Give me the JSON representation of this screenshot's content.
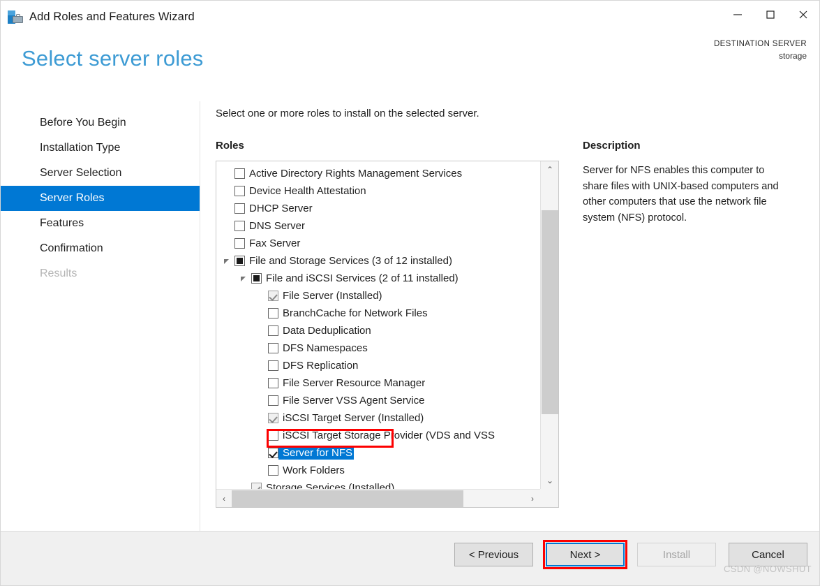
{
  "window": {
    "title": "Add Roles and Features Wizard",
    "icon": "server-toolbox-icon",
    "minimize_label": "—",
    "maximize_label": "□",
    "close_label": "✕"
  },
  "header": {
    "page_title": "Select server roles",
    "destination_label": "DESTINATION SERVER",
    "destination_value": "storage"
  },
  "sidebar": {
    "items": [
      {
        "label": "Before You Begin",
        "state": "normal"
      },
      {
        "label": "Installation Type",
        "state": "normal"
      },
      {
        "label": "Server Selection",
        "state": "normal"
      },
      {
        "label": "Server Roles",
        "state": "selected"
      },
      {
        "label": "Features",
        "state": "normal"
      },
      {
        "label": "Confirmation",
        "state": "normal"
      },
      {
        "label": "Results",
        "state": "disabled"
      }
    ]
  },
  "content": {
    "instruction": "Select one or more roles to install on the selected server.",
    "roles_header": "Roles",
    "description_header": "Description",
    "description_text": "Server for NFS enables this computer to share files with UNIX-based computers and other computers that use the network file system (NFS) protocol."
  },
  "roles_list": [
    {
      "label": "Active Directory Rights Management Services",
      "level": 0,
      "checkbox": "unchecked",
      "expander": "none"
    },
    {
      "label": "Device Health Attestation",
      "level": 0,
      "checkbox": "unchecked",
      "expander": "none"
    },
    {
      "label": "DHCP Server",
      "level": 0,
      "checkbox": "unchecked",
      "expander": "none"
    },
    {
      "label": "DNS Server",
      "level": 0,
      "checkbox": "unchecked",
      "expander": "none"
    },
    {
      "label": "Fax Server",
      "level": 0,
      "checkbox": "unchecked",
      "expander": "none"
    },
    {
      "label": "File and Storage Services (3 of 12 installed)",
      "level": 0,
      "checkbox": "partial",
      "expander": "open"
    },
    {
      "label": "File and iSCSI Services (2 of 11 installed)",
      "level": 1,
      "checkbox": "partial",
      "expander": "open"
    },
    {
      "label": "File Server (Installed)",
      "level": 2,
      "checkbox": "installed",
      "expander": "none"
    },
    {
      "label": "BranchCache for Network Files",
      "level": 2,
      "checkbox": "unchecked",
      "expander": "none"
    },
    {
      "label": "Data Deduplication",
      "level": 2,
      "checkbox": "unchecked",
      "expander": "none"
    },
    {
      "label": "DFS Namespaces",
      "level": 2,
      "checkbox": "unchecked",
      "expander": "none"
    },
    {
      "label": "DFS Replication",
      "level": 2,
      "checkbox": "unchecked",
      "expander": "none"
    },
    {
      "label": "File Server Resource Manager",
      "level": 2,
      "checkbox": "unchecked",
      "expander": "none"
    },
    {
      "label": "File Server VSS Agent Service",
      "level": 2,
      "checkbox": "unchecked",
      "expander": "none"
    },
    {
      "label": "iSCSI Target Server (Installed)",
      "level": 2,
      "checkbox": "installed",
      "expander": "none"
    },
    {
      "label": "iSCSI Target Storage Provider (VDS and VSS",
      "level": 2,
      "checkbox": "unchecked",
      "expander": "none"
    },
    {
      "label": "Server for NFS",
      "level": 2,
      "checkbox": "checked",
      "expander": "none",
      "selected": true,
      "annotated": true
    },
    {
      "label": "Work Folders",
      "level": 2,
      "checkbox": "unchecked",
      "expander": "none"
    },
    {
      "label": "Storage Services (Installed)",
      "level": 1,
      "checkbox": "installed",
      "expander": "none"
    }
  ],
  "scrollbars": {
    "vertical_up_arrow": "⌃",
    "vertical_down_arrow": "⌄",
    "horizontal_left_arrow": "‹",
    "horizontal_right_arrow": "›"
  },
  "footer": {
    "buttons": [
      {
        "label": "< Previous",
        "state": "normal"
      },
      {
        "label": "Next >",
        "state": "focused",
        "annotated": true
      },
      {
        "label": "Install",
        "state": "disabled"
      },
      {
        "label": "Cancel",
        "state": "normal"
      }
    ],
    "watermark": "CSDN @NOWSHUT"
  },
  "colors": {
    "accent": "#0078d4",
    "title_blue": "#3d9bd4",
    "annotation_red": "#fd0000",
    "footer_bg": "#f0f0f0"
  }
}
